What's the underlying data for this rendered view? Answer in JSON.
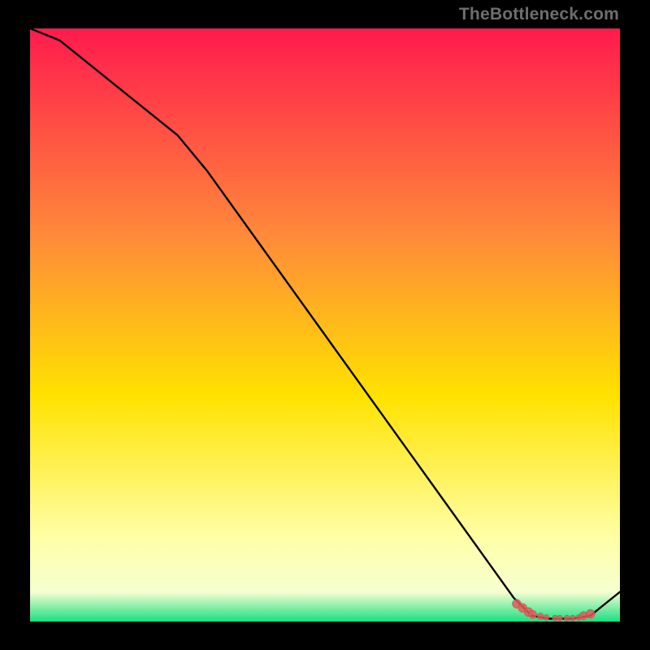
{
  "watermark": "TheBottleneck.com",
  "colors": {
    "black": "#000000",
    "line": "#000000",
    "marker": "#e05a5a",
    "marker_stroke": "#c44",
    "grad_top": "#ff1a4d",
    "grad_orange": "#ff8a3a",
    "grad_yellow": "#ffe200",
    "grad_paleyellow": "#ffffa8",
    "grad_green": "#18e084"
  },
  "chart_data": {
    "type": "line",
    "title": "",
    "xlabel": "",
    "ylabel": "",
    "xlim": [
      0,
      100
    ],
    "ylim": [
      0,
      100
    ],
    "series": [
      {
        "name": "bottleneck-curve",
        "x": [
          0,
          5,
          25,
          30,
          82,
          85,
          88,
          92,
          95,
          100
        ],
        "y": [
          100,
          98,
          82,
          76,
          4,
          1,
          0.5,
          0.5,
          1,
          5
        ]
      }
    ],
    "markers": {
      "name": "highlighted-points",
      "x": [
        82.5,
        83.5,
        84.5,
        85.2,
        86.5,
        87.5,
        89.0,
        89.8,
        91.0,
        92.0,
        93.0,
        93.8,
        95.0
      ],
      "y": [
        3.0,
        2.3,
        1.6,
        1.2,
        0.9,
        0.7,
        0.6,
        0.6,
        0.6,
        0.6,
        0.7,
        1.0,
        1.3
      ],
      "r": [
        5.5,
        5.5,
        5.5,
        5,
        4,
        3.5,
        3.5,
        3.5,
        3.5,
        3.5,
        3.5,
        5,
        5.5
      ]
    }
  }
}
